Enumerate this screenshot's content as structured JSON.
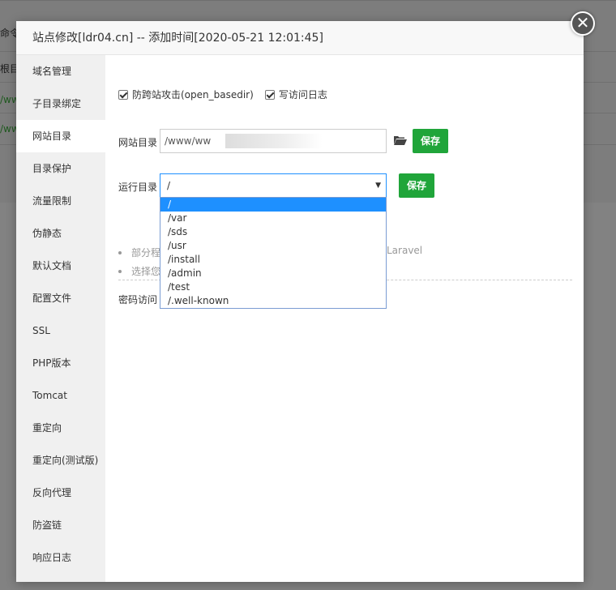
{
  "background": {
    "snippets": [
      "命令",
      "根目",
      "/ww",
      "/ww"
    ]
  },
  "dialog": {
    "title": "站点修改[ldr04.cn] -- 添加时间[2020-05-21 12:01:45]",
    "close_glyph": "✕"
  },
  "sidebar": {
    "items": [
      {
        "label": "域名管理"
      },
      {
        "label": "子目录绑定"
      },
      {
        "label": "网站目录",
        "active": true
      },
      {
        "label": "目录保护"
      },
      {
        "label": "流量限制"
      },
      {
        "label": "伪静态"
      },
      {
        "label": "默认文档"
      },
      {
        "label": "配置文件"
      },
      {
        "label": "SSL"
      },
      {
        "label": "PHP版本"
      },
      {
        "label": "Tomcat"
      },
      {
        "label": "重定向"
      },
      {
        "label": "重定向(测试版)"
      },
      {
        "label": "反向代理"
      },
      {
        "label": "防盗链"
      },
      {
        "label": "响应日志"
      }
    ]
  },
  "options": {
    "anti_xss": {
      "label": "防跨站攻击(open_basedir)",
      "checked": true
    },
    "access_log": {
      "label": "写访问日志",
      "checked": true
    }
  },
  "site_dir": {
    "label": "网站目录",
    "value": "/www/ww",
    "save_label": "保存",
    "folder_icon": "folder-open-icon"
  },
  "run_dir": {
    "label": "运行目录",
    "selected": "/",
    "save_label": "保存",
    "options": [
      "/",
      "/var",
      "/sds",
      "/usr",
      "/install",
      "/admin",
      "/test",
      "/.well-known"
    ]
  },
  "tips": {
    "line1_start": "部分程",
    "line1_end": "Laravel",
    "line2_start": "选择您"
  },
  "password_access": {
    "label": "密码访问"
  },
  "colors": {
    "accent_green": "#20a53a",
    "select_blue": "#1e90ff"
  }
}
